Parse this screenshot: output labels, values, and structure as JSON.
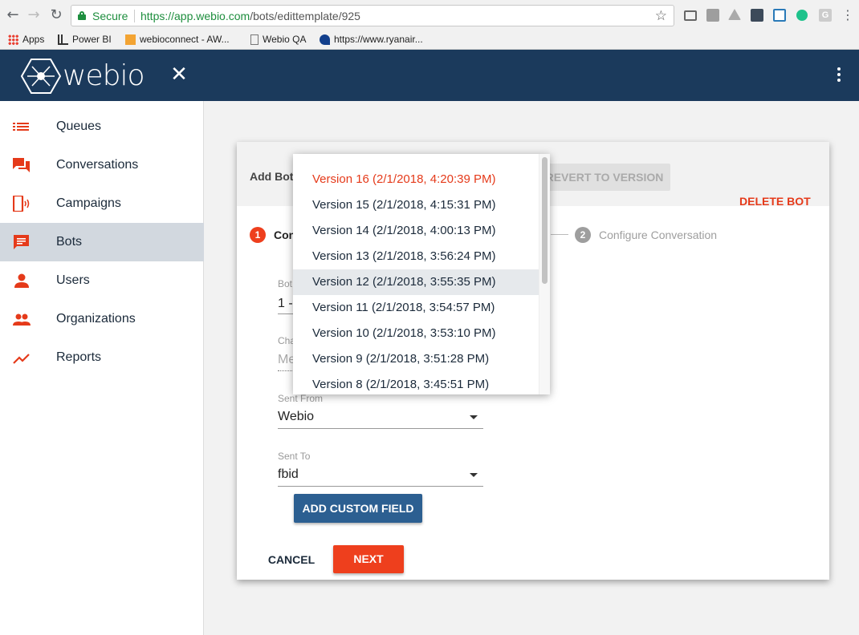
{
  "browser": {
    "secure_label": "Secure",
    "url_scheme_host": "https://app.webio.com",
    "url_path": "/bots/edittemplate/925",
    "bookmarks": [
      "Apps",
      "Power BI",
      "webioconnect - AW...",
      "Webio QA",
      "https://www.ryanair..."
    ]
  },
  "app": {
    "logo_text": "webio",
    "brand_color": "#1b3a5c",
    "accent_color": "#ee3f1d"
  },
  "sidebar": {
    "items": [
      {
        "label": "Queues",
        "icon": "list-icon"
      },
      {
        "label": "Conversations",
        "icon": "chat-icon"
      },
      {
        "label": "Campaigns",
        "icon": "phone-broadcast-icon"
      },
      {
        "label": "Bots",
        "icon": "message-icon",
        "active": true
      },
      {
        "label": "Users",
        "icon": "person-icon"
      },
      {
        "label": "Organizations",
        "icon": "people-icon"
      },
      {
        "label": "Reports",
        "icon": "trending-up-icon"
      }
    ]
  },
  "card": {
    "title": "Add Bot",
    "revert_label": "REVERT TO VERSION",
    "delete_label": "DELETE BOT",
    "steps": [
      {
        "number": "1",
        "label": "Con"
      },
      {
        "number": "2",
        "label": "Configure Conversation"
      }
    ],
    "fields": {
      "bot_label": "Bot",
      "bot_value": "1 -",
      "channel_label": "Cha",
      "channel_value": "Me",
      "sent_from_label": "Sent From",
      "sent_from_value": "Webio",
      "sent_to_label": "Sent To",
      "sent_to_value": "fbid"
    },
    "add_custom_field_label": "ADD CUSTOM FIELD",
    "cancel_label": "CANCEL",
    "next_label": "NEXT"
  },
  "version_dropdown": {
    "items": [
      "Version 16 (2/1/2018, 4:20:39 PM)",
      "Version 15 (2/1/2018, 4:15:31 PM)",
      "Version 14 (2/1/2018, 4:00:13 PM)",
      "Version 13 (2/1/2018, 3:56:24 PM)",
      "Version 12 (2/1/2018, 3:55:35 PM)",
      "Version 11 (2/1/2018, 3:54:57 PM)",
      "Version 10 (2/1/2018, 3:53:10 PM)",
      "Version 9 (2/1/2018, 3:51:28 PM)",
      "Version 8 (2/1/2018, 3:45:51 PM)"
    ],
    "selected_index": 0,
    "hover_index": 4
  }
}
